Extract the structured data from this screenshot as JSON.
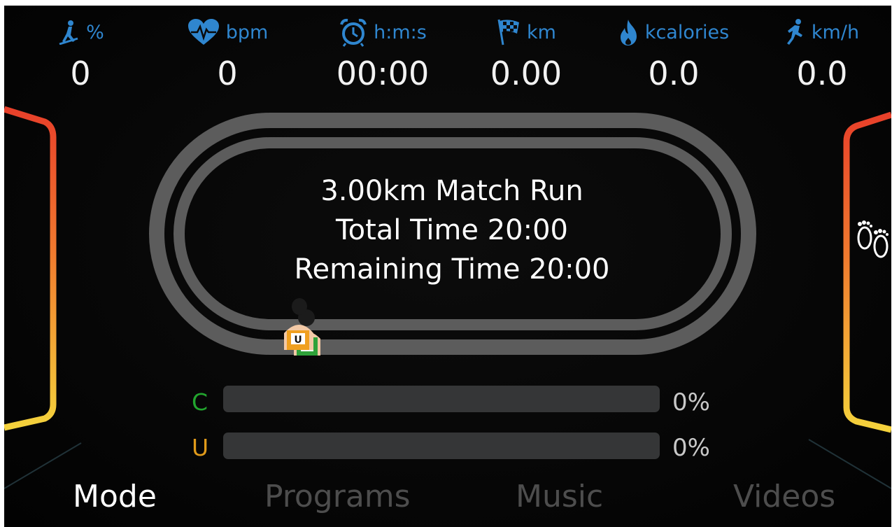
{
  "stats": [
    {
      "icon": "incline-icon",
      "unit": "%",
      "value": "0"
    },
    {
      "icon": "heart-rate-icon",
      "unit": "bpm",
      "value": "0"
    },
    {
      "icon": "alarm-clock-icon",
      "unit": "h:m:s",
      "value": "00:00"
    },
    {
      "icon": "checkered-flag-icon",
      "unit": "km",
      "value": "0.00"
    },
    {
      "icon": "flame-icon",
      "unit": "kcalories",
      "value": "0.0"
    },
    {
      "icon": "runner-icon",
      "unit": "km/h",
      "value": "0.0"
    }
  ],
  "track_info": {
    "line1": "3.00km Match Run",
    "line2": "Total Time 20:00",
    "line3": "Remaining Time 20:00"
  },
  "runners": [
    {
      "bib": "U"
    },
    {
      "bib": "C"
    }
  ],
  "progress": [
    {
      "label": "C",
      "percent_text": "0%",
      "fraction": 0,
      "color": "#22a52e"
    },
    {
      "label": "U",
      "percent_text": "0%",
      "fraction": 0,
      "color": "#e09a1a"
    }
  ],
  "nav": {
    "mode": "Mode",
    "programs": "Programs",
    "music": "Music",
    "videos": "Videos",
    "active": "mode"
  },
  "colors": {
    "accent_blue": "#2f86cf",
    "gauge_top": "#e8402a",
    "gauge_bottom": "#f4d23c",
    "track_gray": "#5c5c5c"
  },
  "side_icon": "footprints-icon"
}
